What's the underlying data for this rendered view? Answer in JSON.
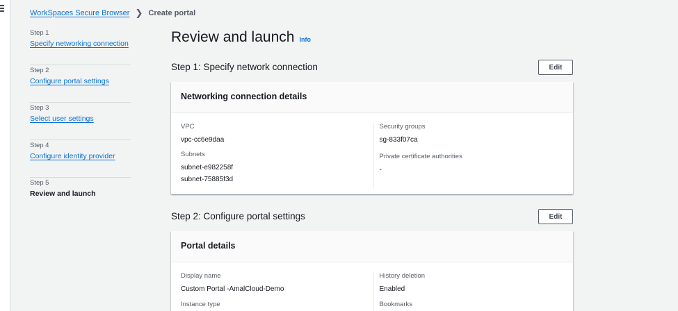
{
  "breadcrumb": {
    "parent": "WorkSpaces Secure Browser",
    "current": "Create portal"
  },
  "steps": [
    {
      "number": "Step 1",
      "label": "Specify networking connection",
      "current": false
    },
    {
      "number": "Step 2",
      "label": "Configure portal settings",
      "current": false
    },
    {
      "number": "Step 3",
      "label": "Select user settings",
      "current": false
    },
    {
      "number": "Step 4",
      "label": "Configure identity provider",
      "current": false
    },
    {
      "number": "Step 5",
      "label": "Review and launch",
      "current": true
    }
  ],
  "page": {
    "title": "Review and launch",
    "info_label": "Info"
  },
  "section1": {
    "heading": "Step 1: Specify network connection",
    "edit_label": "Edit",
    "card_title": "Networking connection details",
    "vpc_label": "VPC",
    "vpc_value": "vpc-cc6e9daa",
    "subnets_label": "Subnets",
    "subnets": [
      "subnet-e982258f",
      "subnet-75885f3d"
    ],
    "sg_label": "Security groups",
    "sg_value": "sg-833f07ca",
    "pca_label": "Private certificate authorities",
    "pca_value": "-"
  },
  "section2": {
    "heading": "Step 2: Configure portal settings",
    "edit_label": "Edit",
    "card_title": "Portal details",
    "display_name_label": "Display name",
    "display_name_value": "Custom Portal -AmalCloud-Demo",
    "instance_type_label": "Instance type",
    "history_label": "History deletion",
    "history_value": "Enabled",
    "bookmarks_label": "Bookmarks"
  },
  "colors": {
    "link": "#0972d3",
    "background": "#f2f3f3",
    "text": "#16191f"
  }
}
